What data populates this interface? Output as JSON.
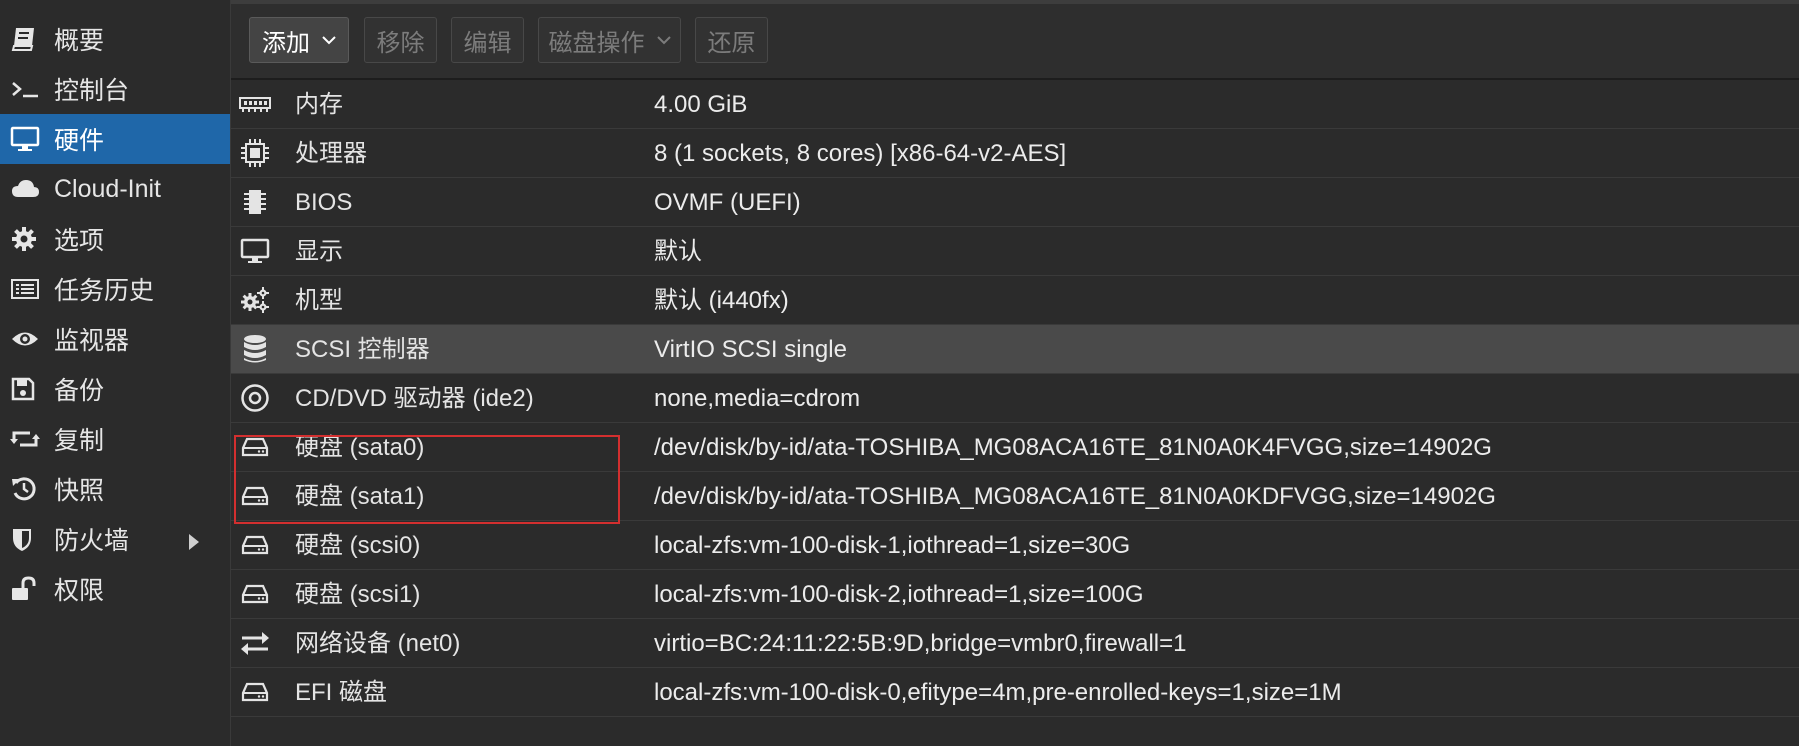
{
  "sidebar": {
    "items": [
      {
        "label": "概要",
        "icon": "book-icon"
      },
      {
        "label": "控制台",
        "icon": "terminal-icon"
      },
      {
        "label": "硬件",
        "icon": "monitor-icon"
      },
      {
        "label": "Cloud-Init",
        "icon": "cloud-icon"
      },
      {
        "label": "选项",
        "icon": "gear-icon"
      },
      {
        "label": "任务历史",
        "icon": "list-icon"
      },
      {
        "label": "监视器",
        "icon": "eye-icon"
      },
      {
        "label": "备份",
        "icon": "floppy-icon"
      },
      {
        "label": "复制",
        "icon": "retweet-icon"
      },
      {
        "label": "快照",
        "icon": "history-icon"
      },
      {
        "label": "防火墙",
        "icon": "shield-icon"
      },
      {
        "label": "权限",
        "icon": "unlock-icon"
      }
    ],
    "active_index": 2
  },
  "toolbar": {
    "add_label": "添加",
    "remove_label": "移除",
    "edit_label": "编辑",
    "disk_action_label": "磁盘操作",
    "revert_label": "还原"
  },
  "hardware": {
    "rows": [
      {
        "name": "内存",
        "value": "4.00 GiB",
        "icon": "memory-icon"
      },
      {
        "name": "处理器",
        "value": "8 (1 sockets, 8 cores) [x86-64-v2-AES]",
        "icon": "cpu-icon"
      },
      {
        "name": "BIOS",
        "value": "OVMF (UEFI)",
        "icon": "chip-icon"
      },
      {
        "name": "显示",
        "value": "默认",
        "icon": "desktop-icon"
      },
      {
        "name": "机型",
        "value": "默认 (i440fx)",
        "icon": "cogs-icon"
      },
      {
        "name": "SCSI 控制器",
        "value": "VirtIO SCSI single",
        "icon": "database-icon"
      },
      {
        "name": "CD/DVD 驱动器 (ide2)",
        "value": "none,media=cdrom",
        "icon": "cdrom-icon"
      },
      {
        "name": "硬盘 (sata0)",
        "value": "/dev/disk/by-id/ata-TOSHIBA_MG08ACA16TE_81N0A0K4FVGG,size=14902G",
        "icon": "hdd-icon"
      },
      {
        "name": "硬盘 (sata1)",
        "value": "/dev/disk/by-id/ata-TOSHIBA_MG08ACA16TE_81N0A0KDFVGG,size=14902G",
        "icon": "hdd-icon"
      },
      {
        "name": "硬盘 (scsi0)",
        "value": "local-zfs:vm-100-disk-1,iothread=1,size=30G",
        "icon": "hdd-icon"
      },
      {
        "name": "硬盘 (scsi1)",
        "value": "local-zfs:vm-100-disk-2,iothread=1,size=100G",
        "icon": "hdd-icon"
      },
      {
        "name": "网络设备 (net0)",
        "value": "virtio=BC:24:11:22:5B:9D,bridge=vmbr0,firewall=1",
        "icon": "exchange-icon"
      },
      {
        "name": "EFI 磁盘",
        "value": "local-zfs:vm-100-disk-0,efitype=4m,pre-enrolled-keys=1,size=1M",
        "icon": "hdd-icon"
      }
    ],
    "selected_index": 5
  },
  "colors": {
    "sidebar_active": "#1f67a9",
    "highlight_box": "#d32f2f",
    "selected_row": "#4a4a4a",
    "background": "#2b2b2b"
  }
}
